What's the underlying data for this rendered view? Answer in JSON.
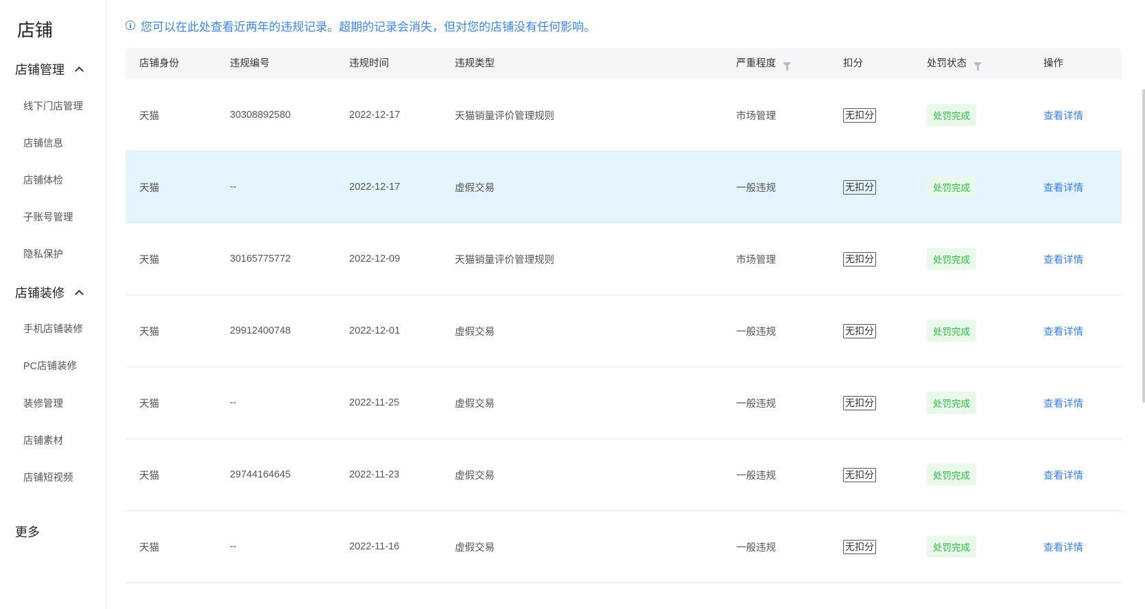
{
  "sidebar": {
    "title": "店铺",
    "groups": [
      {
        "label": "店铺管理",
        "items": [
          "线下门店管理",
          "店铺信息",
          "店铺体检",
          "子账号管理",
          "隐私保护"
        ]
      },
      {
        "label": "店铺装修",
        "items": [
          "手机店铺装修",
          "PC店铺装修",
          "装修管理",
          "店铺素材",
          "店铺短视频"
        ]
      }
    ],
    "more": "更多"
  },
  "notice": "您可以在此处查看近两年的违规记录。超期的记录会消失，但对您的店铺没有任何影响。",
  "table": {
    "headers": [
      "店铺身份",
      "违规编号",
      "违规时间",
      "违规类型",
      "严重程度",
      "扣分",
      "处罚状态",
      "操作"
    ],
    "rows": [
      {
        "identity": "天猫",
        "id": "30308892580",
        "date": "2022-12-17",
        "type": "天猫销量评价管理规则",
        "severity": "市场管理",
        "score": "无扣分",
        "status": "处罚完成",
        "action": "查看详情"
      },
      {
        "identity": "天猫",
        "id": "--",
        "date": "2022-12-17",
        "type": "虚假交易",
        "severity": "一般违规",
        "score": "无扣分",
        "status": "处罚完成",
        "action": "查看详情"
      },
      {
        "identity": "天猫",
        "id": "30165775772",
        "date": "2022-12-09",
        "type": "天猫销量评价管理规则",
        "severity": "市场管理",
        "score": "无扣分",
        "status": "处罚完成",
        "action": "查看详情"
      },
      {
        "identity": "天猫",
        "id": "29912400748",
        "date": "2022-12-01",
        "type": "虚假交易",
        "severity": "一般违规",
        "score": "无扣分",
        "status": "处罚完成",
        "action": "查看详情"
      },
      {
        "identity": "天猫",
        "id": "--",
        "date": "2022-11-25",
        "type": "虚假交易",
        "severity": "一般违规",
        "score": "无扣分",
        "status": "处罚完成",
        "action": "查看详情"
      },
      {
        "identity": "天猫",
        "id": "29744164645",
        "date": "2022-11-23",
        "type": "虚假交易",
        "severity": "一般违规",
        "score": "无扣分",
        "status": "处罚完成",
        "action": "查看详情"
      },
      {
        "identity": "天猫",
        "id": "--",
        "date": "2022-11-16",
        "type": "虚假交易",
        "severity": "一般违规",
        "score": "无扣分",
        "status": "处罚完成",
        "action": "查看详情"
      }
    ]
  },
  "colors": {
    "accent": "#3b7fe8",
    "status_bg": "#e8f8ea",
    "status_text": "#2fb843",
    "highlight_row": "#e4f4fc"
  }
}
